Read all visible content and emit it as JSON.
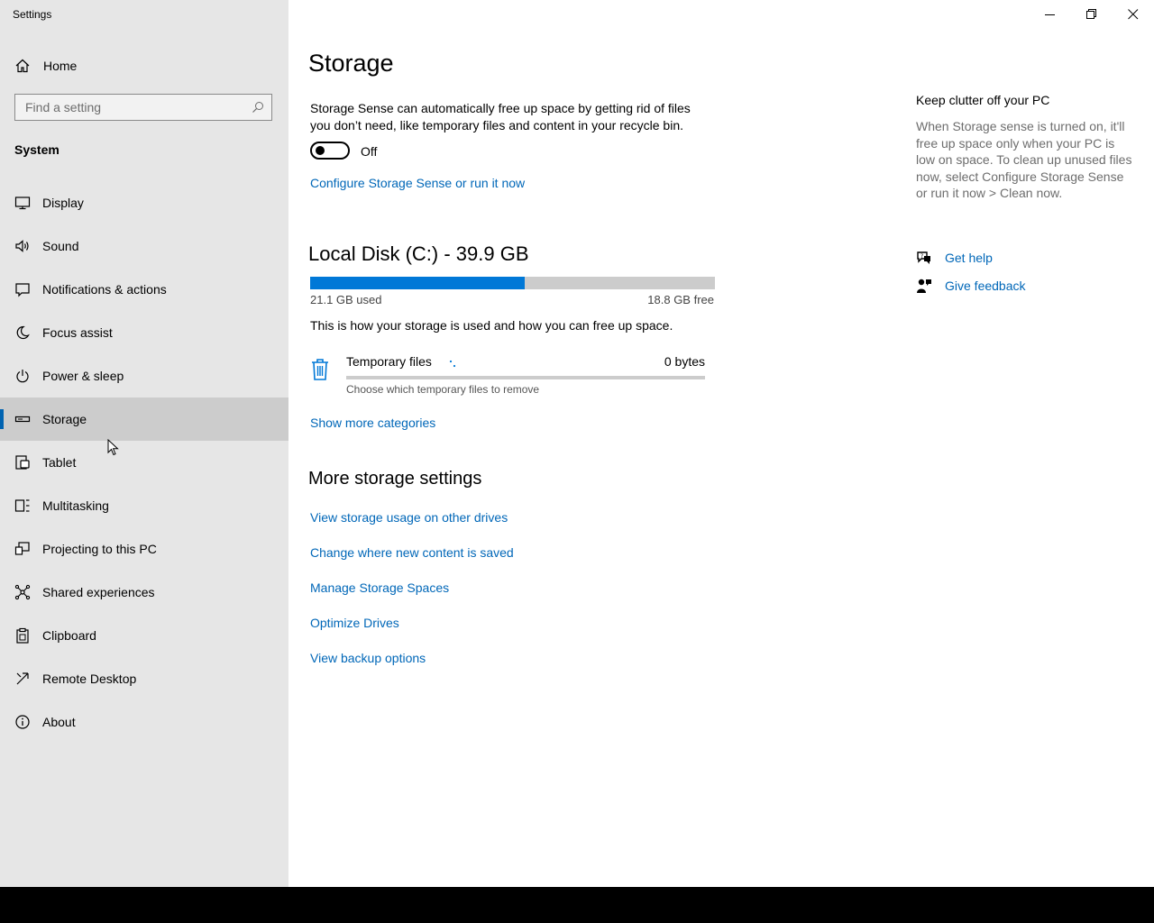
{
  "window": {
    "title": "Settings"
  },
  "sidebar": {
    "home_label": "Home",
    "search_placeholder": "Find a setting",
    "section": "System",
    "items": [
      {
        "label": "Display",
        "icon": "monitor-icon"
      },
      {
        "label": "Sound",
        "icon": "speaker-icon"
      },
      {
        "label": "Notifications & actions",
        "icon": "notification-icon"
      },
      {
        "label": "Focus assist",
        "icon": "moon-icon"
      },
      {
        "label": "Power & sleep",
        "icon": "power-icon"
      },
      {
        "label": "Storage",
        "icon": "storage-drive-icon",
        "selected": true
      },
      {
        "label": "Tablet",
        "icon": "tablet-icon"
      },
      {
        "label": "Multitasking",
        "icon": "multitasking-icon"
      },
      {
        "label": "Projecting to this PC",
        "icon": "projecting-icon"
      },
      {
        "label": "Shared experiences",
        "icon": "shared-experiences-icon"
      },
      {
        "label": "Clipboard",
        "icon": "clipboard-icon"
      },
      {
        "label": "Remote Desktop",
        "icon": "remote-desktop-icon"
      },
      {
        "label": "About",
        "icon": "info-icon"
      }
    ]
  },
  "main": {
    "title": "Storage",
    "storage_sense_desc": "Storage Sense can automatically free up space by getting rid of files you don’t need, like temporary files and content in your recycle bin.",
    "toggle_state": "Off",
    "configure_link": "Configure Storage Sense or run it now",
    "disk": {
      "title": "Local Disk (C:) - 39.9 GB",
      "used_label": "21.1 GB used",
      "free_label": "18.8 GB free",
      "used_fraction": 0.529
    },
    "explain": "This is how your storage is used and how you can free up space.",
    "category": {
      "name": "Temporary files",
      "size": "0 bytes",
      "sub": "Choose which temporary files to remove"
    },
    "show_more": "Show more categories",
    "more_title": "More storage settings",
    "more_links": [
      "View storage usage on other drives",
      "Change where new content is saved",
      "Manage Storage Spaces",
      "Optimize Drives",
      "View backup options"
    ]
  },
  "right": {
    "title": "Keep clutter off your PC",
    "body": "When Storage sense is turned on, it'll free up space only when your PC is low on space. To clean up unused files now, select Configure Storage Sense or run it now > Clean now.",
    "get_help": "Get help",
    "give_feedback": "Give feedback"
  },
  "colors": {
    "accent": "#0078d7",
    "link": "#0067b8",
    "sidebar_bg": "#e6e6e6",
    "selected_bg": "#cccccc"
  }
}
